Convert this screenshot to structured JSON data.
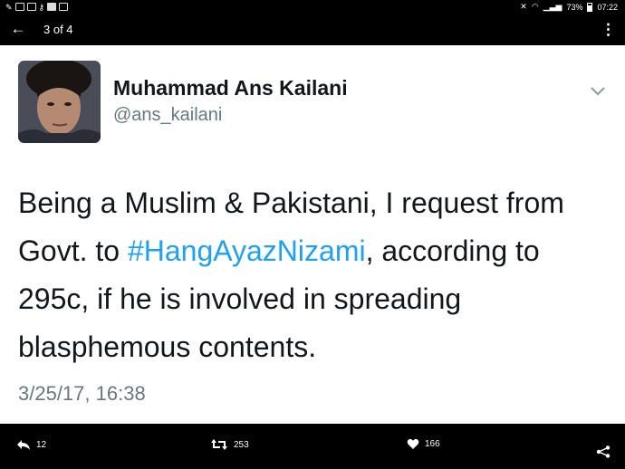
{
  "statusbar": {
    "battery": "73%",
    "time": "07:22",
    "left_icons": [
      "wrench-icon",
      "image-icon",
      "mail-icon",
      "key-icon",
      "video-icon",
      "gallery-icon"
    ],
    "right_icons": [
      "mute-icon",
      "wifi-icon",
      "signal-icon",
      "battery-icon"
    ]
  },
  "appbar": {
    "counter": "3 of 4",
    "back_icon": "back-arrow-icon",
    "menu_icon": "more-vert-icon"
  },
  "tweet": {
    "author_name": "Muhammad Ans Kailani",
    "author_handle": "@ans_kailani",
    "text_before": "Being a Muslim & Pakistani, I request from Govt. to ",
    "hashtag": "#HangAyazNizami",
    "text_after": ", according to 295c, if he is involved in spreading blasphemous contents.",
    "timestamp": "3/25/17, 16:38",
    "hashtag_color": "#1da1f2"
  },
  "actions": {
    "reply_count": "12",
    "retweet_count": "253",
    "like_count": "166",
    "reply_icon": "reply-icon",
    "retweet_icon": "retweet-icon",
    "like_icon": "heart-icon",
    "share_icon": "share-icon"
  }
}
